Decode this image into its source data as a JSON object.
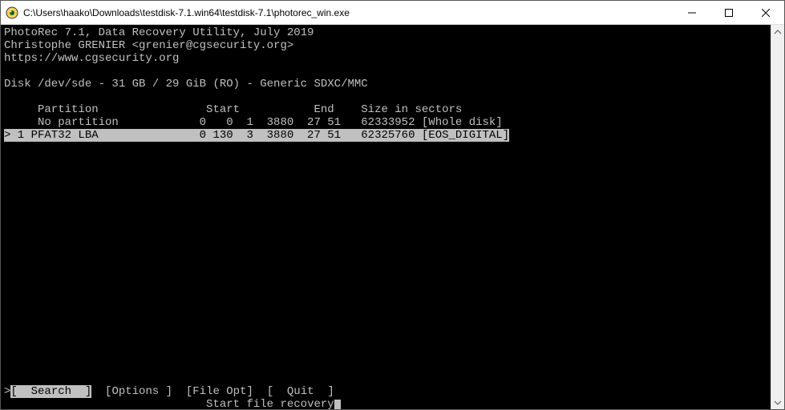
{
  "window": {
    "title": "C:\\Users\\haako\\Downloads\\testdisk-7.1.win64\\testdisk-7.1\\photorec_win.exe"
  },
  "header": {
    "line1": "PhotoRec 7.1, Data Recovery Utility, July 2019",
    "line2": "Christophe GRENIER <grenier@cgsecurity.org>",
    "line3": "https://www.cgsecurity.org"
  },
  "disk_info": "Disk /dev/sde - 31 GB / 29 GiB (RO) - Generic SDXC/MMC",
  "table_header": {
    "partition": "Partition",
    "start": "Start",
    "end": "End",
    "size": "Size in sectors"
  },
  "partitions": [
    {
      "marker": "   ",
      "name": "No partition",
      "start": "  0   0  1",
      "end": "3880  27 51",
      "size": "62333952",
      "label": "[Whole disk]",
      "selected": false
    },
    {
      "marker": "> 1 P",
      "name": "FAT32 LBA",
      "start": "  0 130  3",
      "end": "3880  27 51",
      "size": "62325760",
      "label": "[EOS_DIGITAL]",
      "selected": true
    }
  ],
  "menu": {
    "prefix": ">",
    "items": [
      {
        "label": "[  Search  ]",
        "selected": true
      },
      {
        "label": "[Options ]",
        "selected": false
      },
      {
        "label": "[File Opt]",
        "selected": false
      },
      {
        "label": "[  Quit  ]",
        "selected": false
      }
    ],
    "hint": "Start file recovery"
  }
}
